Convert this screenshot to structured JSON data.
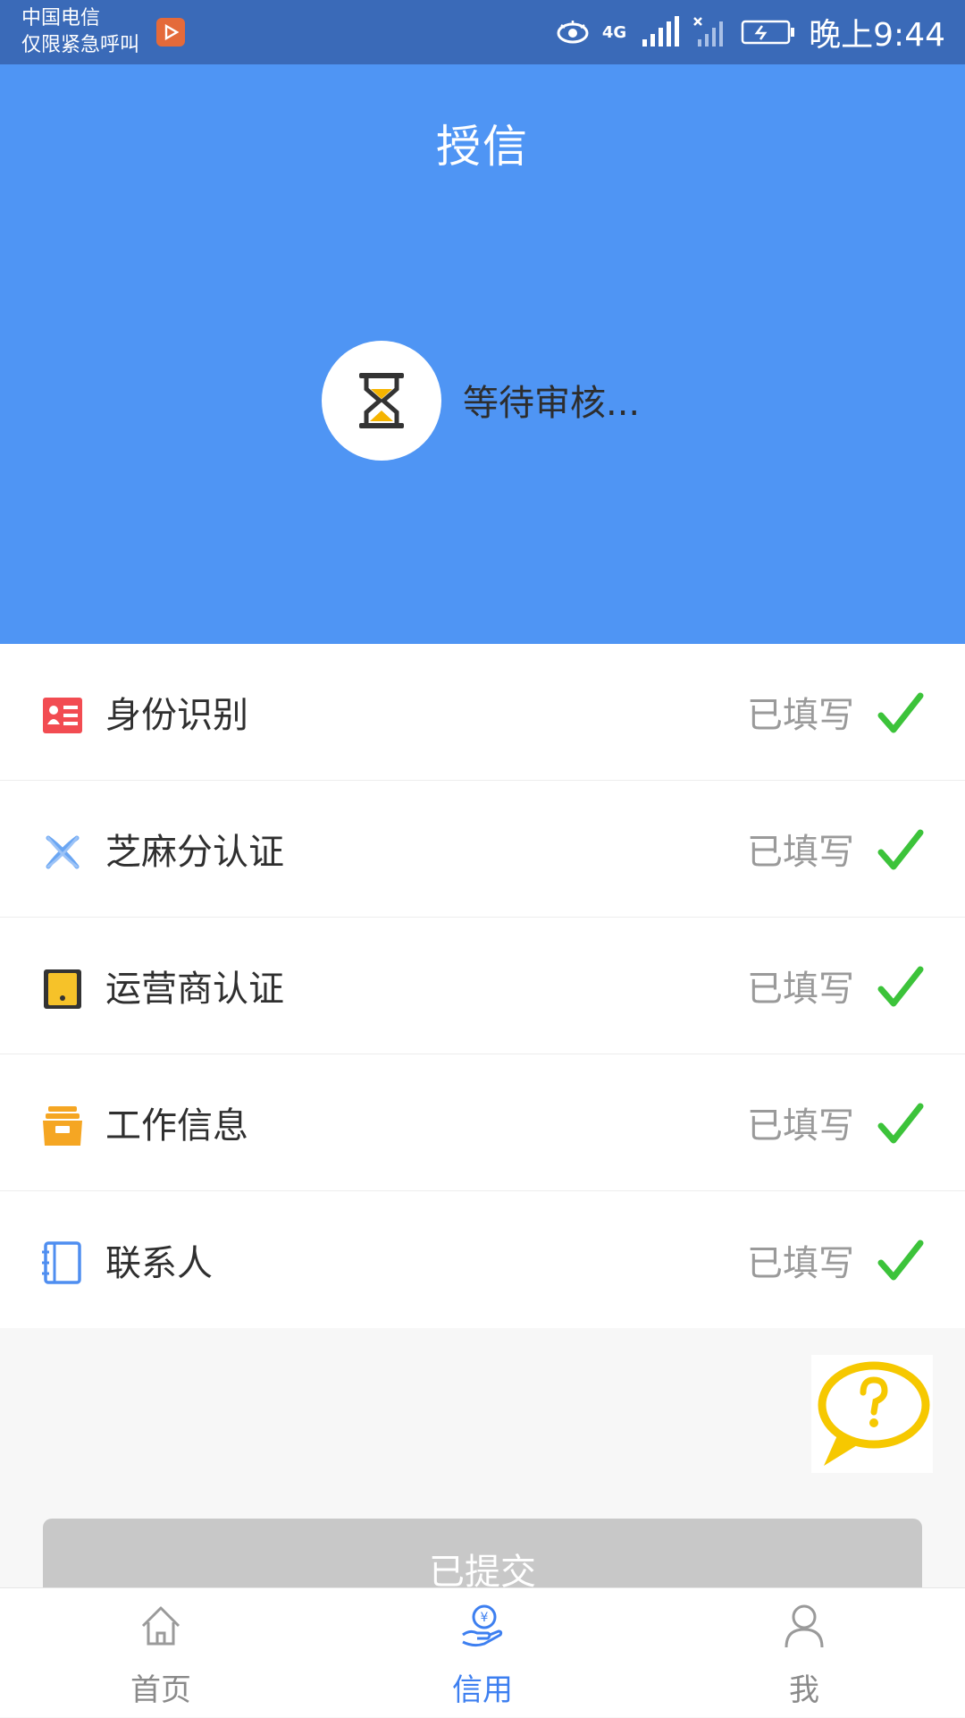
{
  "status_bar": {
    "carrier_line1": "中国电信",
    "carrier_line2": "仅限紧急呼叫",
    "network": "4G",
    "time": "晚上9:44"
  },
  "header": {
    "title": "授信",
    "status_text": "等待审核..."
  },
  "list": {
    "items": [
      {
        "label": "身份识别",
        "status": "已填写",
        "icon": "id-card-icon"
      },
      {
        "label": "芝麻分认证",
        "status": "已填写",
        "icon": "sesame-credit-icon"
      },
      {
        "label": "运营商认证",
        "status": "已填写",
        "icon": "mobile-phone-icon"
      },
      {
        "label": "工作信息",
        "status": "已填写",
        "icon": "work-box-icon"
      },
      {
        "label": "联系人",
        "status": "已填写",
        "icon": "address-book-icon"
      }
    ]
  },
  "submit": {
    "label": "已提交"
  },
  "tabbar": {
    "tabs": [
      {
        "label": "首页",
        "icon": "home-icon"
      },
      {
        "label": "信用",
        "icon": "credit-hand-icon"
      },
      {
        "label": "我",
        "icon": "user-icon"
      }
    ]
  },
  "colors": {
    "header_blue": "#4f95f4",
    "status_bar": "#3a6ab8",
    "check_green": "#3cc33a",
    "tab_active": "#3d7ff0",
    "tab_inactive": "#8a8a8a",
    "button_disabled": "#c8c8c8"
  }
}
